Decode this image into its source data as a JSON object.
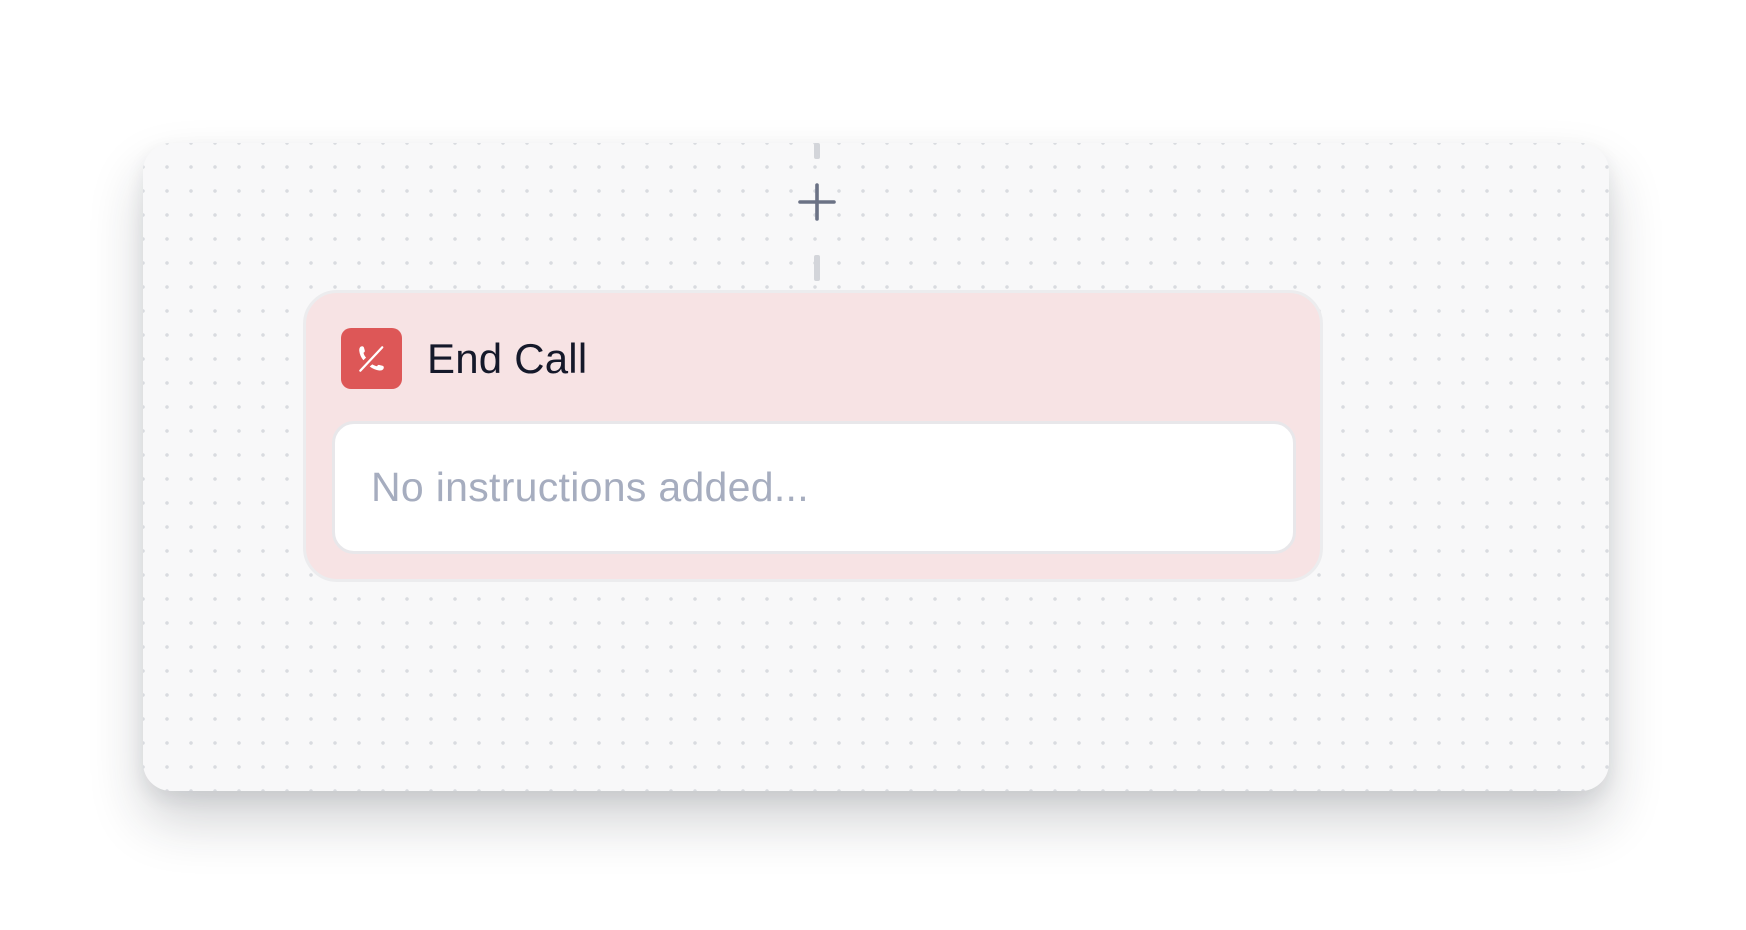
{
  "canvas": {
    "add_step_icon": "plus-icon"
  },
  "node": {
    "icon": "phone-off-icon",
    "icon_color": "#dd5757",
    "card_color": "#f7e3e4",
    "title": "End Call",
    "instructions_placeholder": "No instructions added..."
  }
}
